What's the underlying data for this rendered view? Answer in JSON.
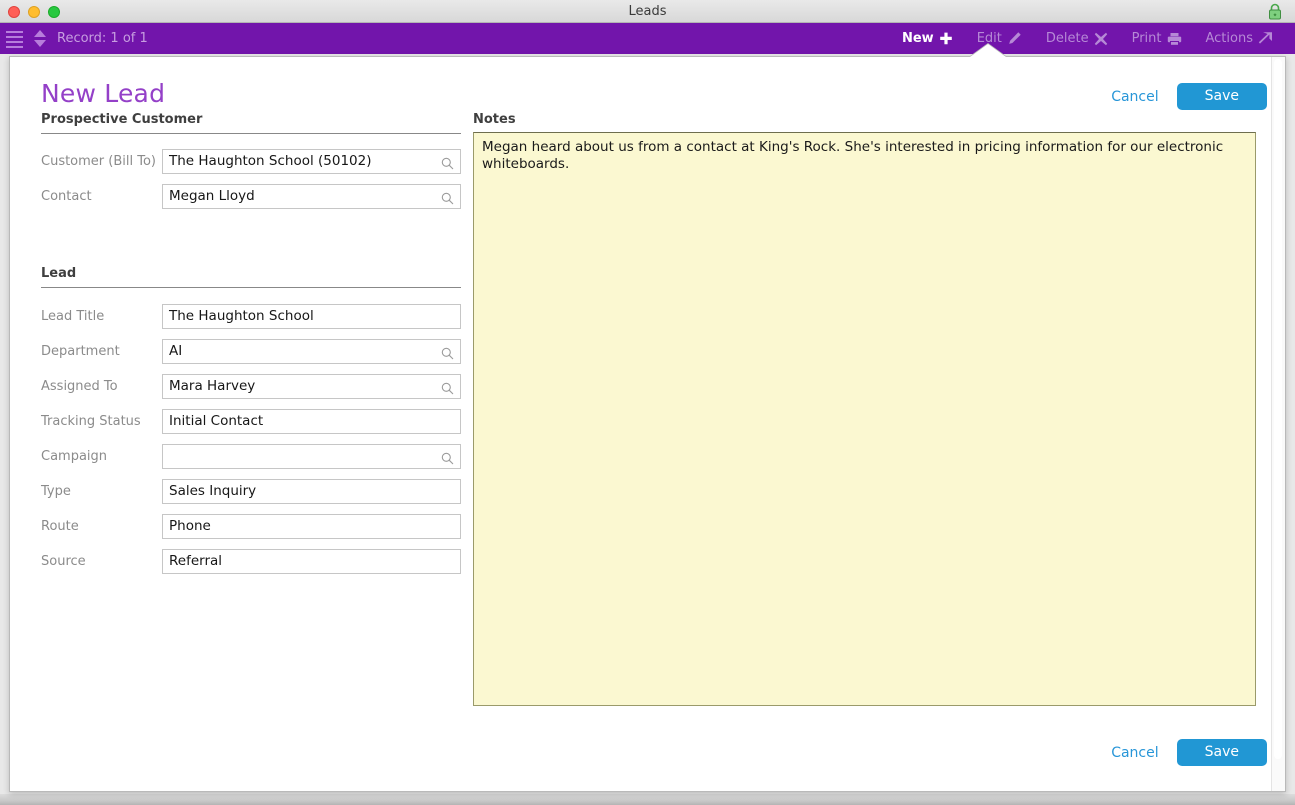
{
  "window": {
    "title": "Leads",
    "traffic_lights": [
      "close",
      "minimize",
      "zoom"
    ],
    "lock_icon": "lock-icon"
  },
  "toolbar": {
    "menu_icon": "hamburger-icon",
    "record_nav_icon": "up-down-arrows-icon",
    "record_label": "Record: 1 of 1",
    "actions": [
      {
        "label": "New",
        "icon": "plus-icon",
        "active": true
      },
      {
        "label": "Edit",
        "icon": "pencil-icon",
        "active": false
      },
      {
        "label": "Delete",
        "icon": "x-cross-icon",
        "active": false
      },
      {
        "label": "Print",
        "icon": "printer-icon",
        "active": false
      },
      {
        "label": "Actions",
        "icon": "arrow-out-icon",
        "active": false
      }
    ]
  },
  "dialog": {
    "title": "New Lead",
    "cancel_label": "Cancel",
    "save_label": "Save",
    "sections": {
      "prospective_customer": {
        "heading": "Prospective Customer",
        "fields": [
          {
            "label": "Customer (Bill To)",
            "value": "The Haughton School  (50102)",
            "lookup": true
          },
          {
            "label": "Contact",
            "value": "Megan Lloyd",
            "lookup": true
          }
        ]
      },
      "lead": {
        "heading": "Lead",
        "fields": [
          {
            "label": "Lead Title",
            "value": "The Haughton School",
            "lookup": false
          },
          {
            "label": "Department",
            "value": "AI",
            "lookup": true
          },
          {
            "label": "Assigned To",
            "value": "Mara Harvey",
            "lookup": true
          },
          {
            "label": "Tracking Status",
            "value": "Initial Contact",
            "lookup": false
          },
          {
            "label": "Campaign",
            "value": "",
            "lookup": true
          },
          {
            "label": "Type",
            "value": "Sales Inquiry",
            "lookup": false
          },
          {
            "label": "Route",
            "value": "Phone",
            "lookup": false
          },
          {
            "label": "Source",
            "value": "Referral",
            "lookup": false
          }
        ]
      }
    },
    "notes": {
      "heading": "Notes",
      "text": "Megan heard about us from a contact at King's Rock. She's interested in pricing information for our electronic whiteboards."
    }
  },
  "colors": {
    "toolbar_purple": "#7215ab",
    "title_purple": "#9440c8",
    "accent_blue": "#2197d4",
    "notes_yellow": "#fbf8d1"
  }
}
